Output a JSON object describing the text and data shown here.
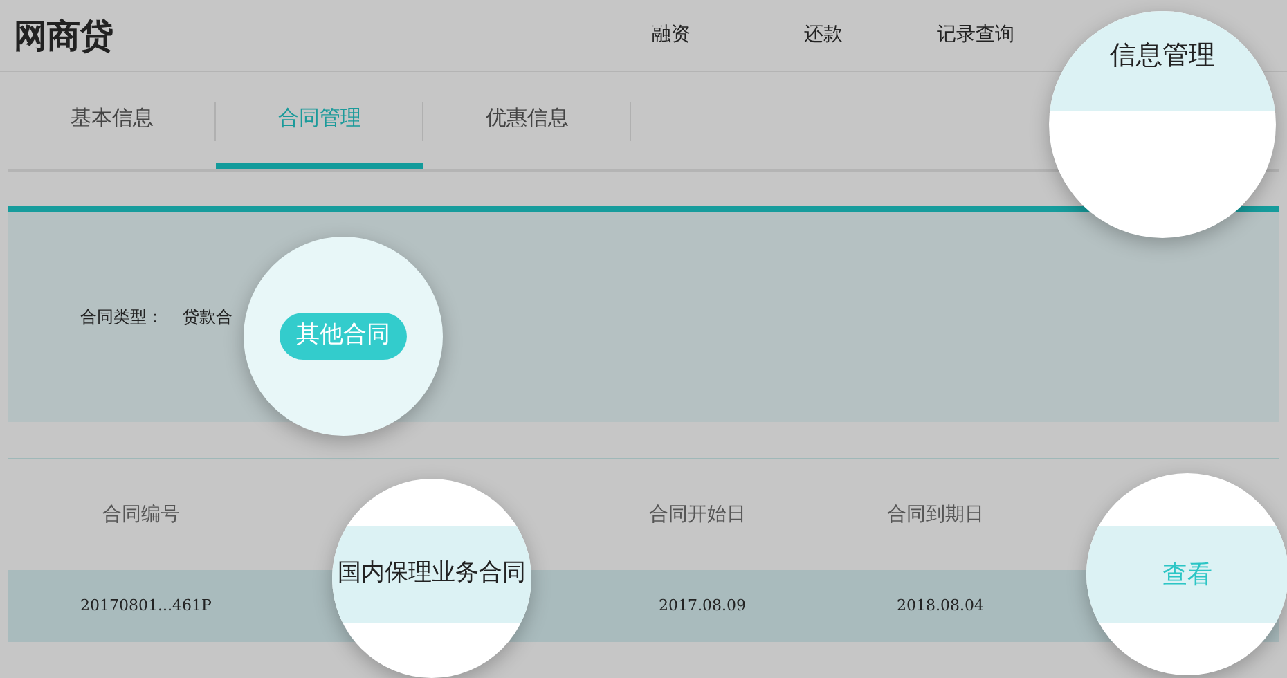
{
  "header": {
    "logo": "网商贷",
    "nav": [
      {
        "label": "融资"
      },
      {
        "label": "还款"
      },
      {
        "label": "记录查询"
      }
    ]
  },
  "tabs": [
    {
      "label": "基本信息",
      "selected": false
    },
    {
      "label": "合同管理",
      "selected": true
    },
    {
      "label": "优惠信息",
      "selected": false
    }
  ],
  "filter": {
    "label": "合同类型：",
    "option": "贷款合"
  },
  "table": {
    "columns": [
      "合同编号",
      "合同开始日",
      "合同到期日"
    ],
    "rows": [
      {
        "contract_no": "20170801...461P",
        "start_date": "2017.08.09",
        "end_date": "2018.08.04"
      }
    ]
  },
  "spotlights": [
    {
      "kind": "nav",
      "text": "信息管理"
    },
    {
      "kind": "pill",
      "text": "其他合同"
    },
    {
      "kind": "cell",
      "text": "国内保理业务合同"
    },
    {
      "kind": "link",
      "text": "查看"
    }
  ]
}
